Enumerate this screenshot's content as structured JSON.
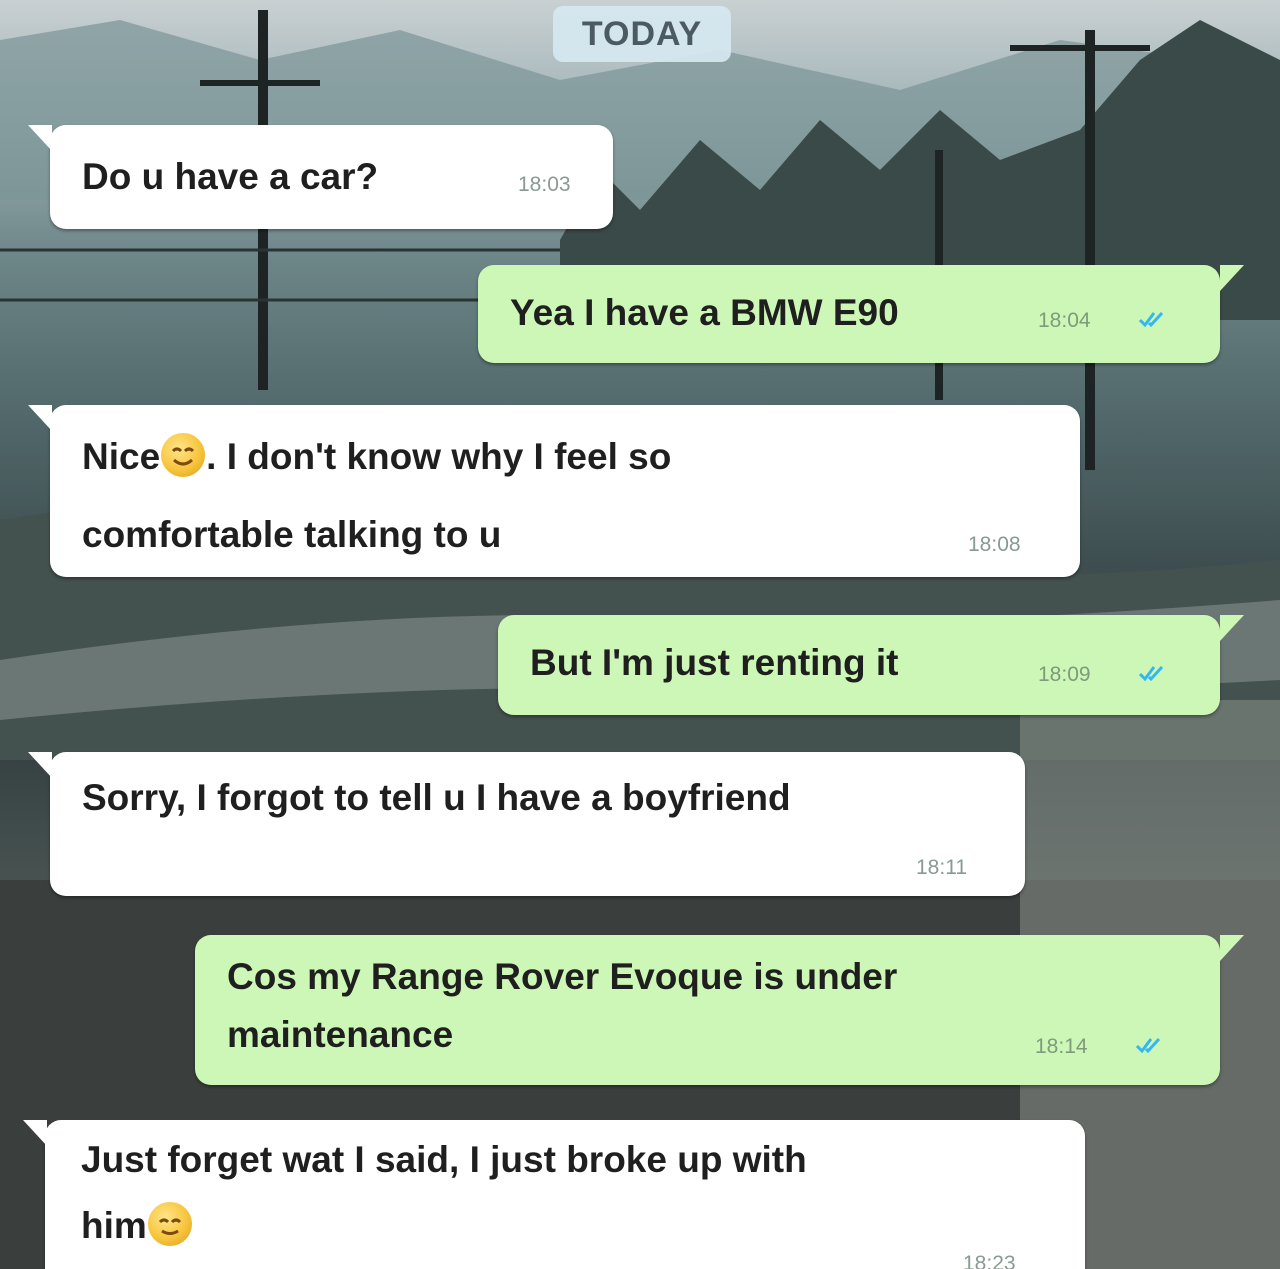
{
  "date_separator": "TODAY",
  "messages": [
    {
      "direction": "incoming",
      "lines": [
        "Do u have a car?"
      ],
      "time": "18:03"
    },
    {
      "direction": "outgoing",
      "lines": [
        "Yea I have a BMW E90"
      ],
      "time": "18:04",
      "status": "read"
    },
    {
      "direction": "incoming",
      "lines": [
        "Nice",
        ". I don't know why I feel so",
        "comfortable talking to u"
      ],
      "time": "18:08",
      "emoji": "smiling-face-emoji"
    },
    {
      "direction": "outgoing",
      "lines": [
        "But I'm just renting it"
      ],
      "time": "18:09",
      "status": "read"
    },
    {
      "direction": "incoming",
      "lines": [
        "Sorry, I forgot to tell u I have a boyfriend"
      ],
      "time": "18:11"
    },
    {
      "direction": "outgoing",
      "lines": [
        "Cos my Range Rover Evoque is under",
        "maintenance"
      ],
      "time": "18:14",
      "status": "read"
    },
    {
      "direction": "incoming",
      "lines": [
        "Just forget wat I said, I just broke up with",
        "him"
      ],
      "time": "18:23",
      "emoji": "smiling-face-emoji"
    }
  ],
  "colors": {
    "incoming_bubble": "#ffffff",
    "outgoing_bubble": "#cdf7b6",
    "read_ticks": "#34b7f1",
    "date_chip": "#d6e8f0"
  },
  "icons": [
    "double-check-icon",
    "smiling-face-emoji"
  ]
}
